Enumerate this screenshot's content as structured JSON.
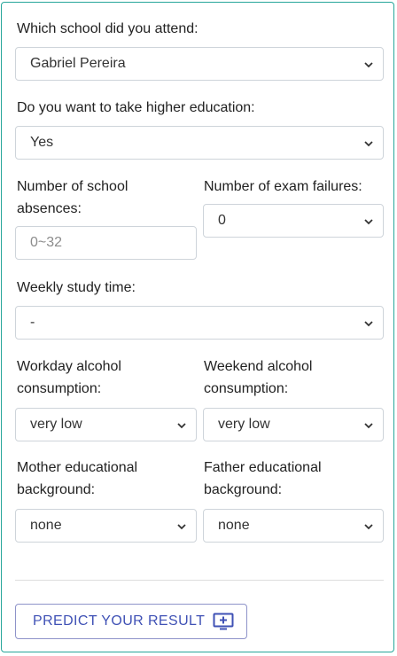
{
  "fields": {
    "school": {
      "label": "Which school did you attend:",
      "value": "Gabriel Pereira"
    },
    "higher_education": {
      "label": "Do you want to take higher education:",
      "value": "Yes"
    },
    "absences": {
      "label": "Number of school absences:",
      "placeholder": "0~32"
    },
    "failures": {
      "label": "Number of exam failures:",
      "value": "0"
    },
    "study_time": {
      "label": "Weekly study time:",
      "value": "-"
    },
    "workday_alcohol": {
      "label": "Workday alcohol consumption:",
      "value": "very low"
    },
    "weekend_alcohol": {
      "label": "Weekend alcohol consumption:",
      "value": "very low"
    },
    "mother_education": {
      "label": "Mother educational background:",
      "value": "none"
    },
    "father_education": {
      "label": "Father educational background:",
      "value": "none"
    }
  },
  "predict_button": {
    "label": "PREDICT YOUR RESULT",
    "icon": "monitor-plus-icon",
    "color": "#3f51b5"
  },
  "colors": {
    "card_border": "#26a69a",
    "field_border": "#ced4da"
  }
}
